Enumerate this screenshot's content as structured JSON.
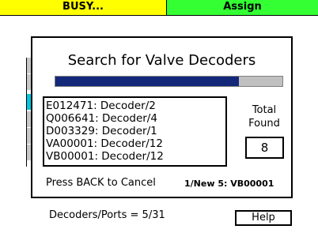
{
  "tabs": {
    "busy_label": "BUSY...",
    "assign_label": "Assign",
    "busy_color": "#ffff00",
    "assign_color": "#33ff33"
  },
  "dialog": {
    "title": "Search for Valve Decoders",
    "progress_fraction": 0.81,
    "progress_color": "#14287a",
    "results": [
      "E012471: Decoder/2",
      "Q006641: Decoder/4",
      "D003329: Decoder/1",
      "VA00001: Decoder/12",
      "VB00001: Decoder/12"
    ],
    "total_label_line1": "Total",
    "total_label_line2": "Found",
    "total_value": "8",
    "back_hint": "Press BACK to Cancel",
    "status": "1/New 5: VB00001"
  },
  "footer": {
    "decoders_ports": "Decoders/Ports = 5/31",
    "help_label": "Help"
  }
}
